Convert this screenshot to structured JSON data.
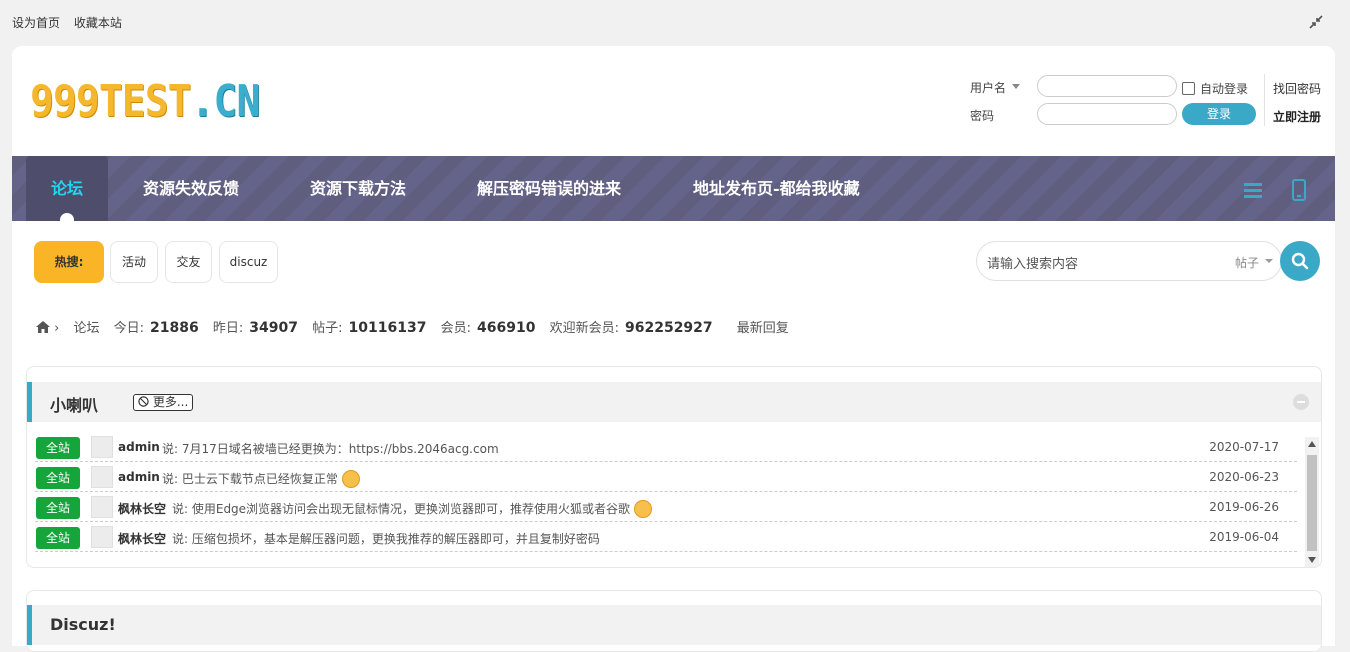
{
  "topbar": {
    "set_home": "设为首页",
    "bookmark": "收藏本站"
  },
  "header": {
    "logo_part1": "999TEST",
    "logo_part2": ".CN",
    "login": {
      "username_label": "用户名",
      "password_label": "密码",
      "auto_login": "自动登录",
      "login_button": "登录",
      "forgot_password": "找回密码",
      "register": "立即注册"
    }
  },
  "nav": {
    "items": [
      {
        "label": "论坛"
      },
      {
        "label": "资源失效反馈"
      },
      {
        "label": "资源下载方法"
      },
      {
        "label": "解压密码错误的进来"
      },
      {
        "label": "地址发布页-都给我收藏"
      }
    ]
  },
  "hot_search": {
    "label": "热搜:",
    "tags": [
      "活动",
      "交友",
      "discuz"
    ]
  },
  "search": {
    "placeholder": "请输入搜索内容",
    "type": "帖子"
  },
  "stats": {
    "breadcrumb": "论坛",
    "today_label": "今日:",
    "today": "21886",
    "yesterday_label": "昨日:",
    "yesterday": "34907",
    "posts_label": "帖子:",
    "posts": "10116137",
    "members_label": "会员:",
    "members": "466910",
    "newest_label": "欢迎新会员:",
    "newest": "962252927",
    "latest_reply": "最新回复"
  },
  "announcements": {
    "title": "小喇叭",
    "more": "更多...",
    "rows": [
      {
        "tag": "全站",
        "author": "admin",
        "text": "说: 7月17日域名被墙已经更换为：https://bbs.2046acg.com",
        "date": "2020-07-17"
      },
      {
        "tag": "全站",
        "author": "admin",
        "text": "说: 巴士云下载节点已经恢复正常",
        "date": "2020-06-23"
      },
      {
        "tag": "全站",
        "author": "枫林长空",
        "text": "说: 使用Edge浏览器访问会出现无鼠标情况，更换浏览器即可，推荐使用火狐或者谷歌",
        "date": "2019-06-26"
      },
      {
        "tag": "全站",
        "author": "枫林长空",
        "text": "说: 压缩包损坏，基本是解压器问题，更换我推荐的解压器即可，并且复制好密码",
        "date": "2019-06-04"
      }
    ]
  },
  "section2": {
    "title": "Discuz!"
  },
  "colors": {
    "accent": "#3aa9c8",
    "nav_bg": "#5f5e7e",
    "hot": "#f9b525",
    "tag": "#16a53a"
  }
}
